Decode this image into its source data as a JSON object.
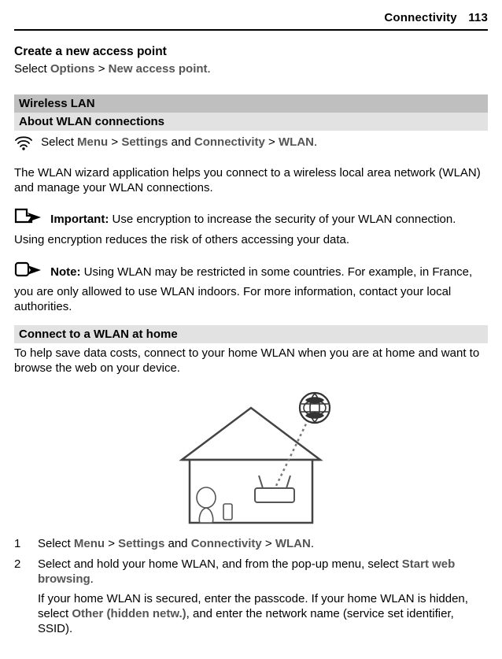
{
  "header": {
    "section": "Connectivity",
    "page": "113"
  },
  "sec1": {
    "title": "Create a new access point",
    "body_1": "Select ",
    "options": "Options",
    "sep": " > ",
    "newap": "New access point",
    "tail": "."
  },
  "bar1": "Wireless LAN ",
  "bar2": "About WLAN connections",
  "nav": {
    "select": "Select ",
    "menu": "Menu",
    "sep": " > ",
    "settings": "Settings",
    "and": " and ",
    "conn": "Connectivity",
    "wlan": "WLAN",
    "tail": "."
  },
  "p1": "The WLAN wizard application helps you connect to a wireless local area network (WLAN) and manage your WLAN connections.",
  "imp": {
    "label": "Important:",
    "body": " Use encryption to increase the security of your WLAN connection. Using encryption reduces the risk of others accessing your data."
  },
  "note": {
    "label": "Note:",
    "body": " Using WLAN may be restricted in some countries. For example, in France, you are only allowed to use WLAN indoors. For more information, contact your local authorities."
  },
  "bar3": "Connect to a WLAN at home",
  "p2": "To help save data costs, connect to your home WLAN when you are at home and want to browse the web on your device.",
  "steps": {
    "s1": {
      "n": "1",
      "a": "Select ",
      "menu": "Menu",
      "sep": " > ",
      "settings": "Settings",
      "and": " and ",
      "conn": "Connectivity",
      "wlan": "WLAN",
      "tail": "."
    },
    "s2": {
      "n": "2",
      "a": "Select and hold your home WLAN, and from the pop-up menu, select ",
      "swb": "Start web browsing",
      "dot": ".",
      "a2": "If your home WLAN is secured, enter the passcode. If your home WLAN is hidden, select ",
      "ohn": "Other (hidden netw.)",
      "a3": ", and enter the network name (service set identifier, SSID)."
    }
  }
}
